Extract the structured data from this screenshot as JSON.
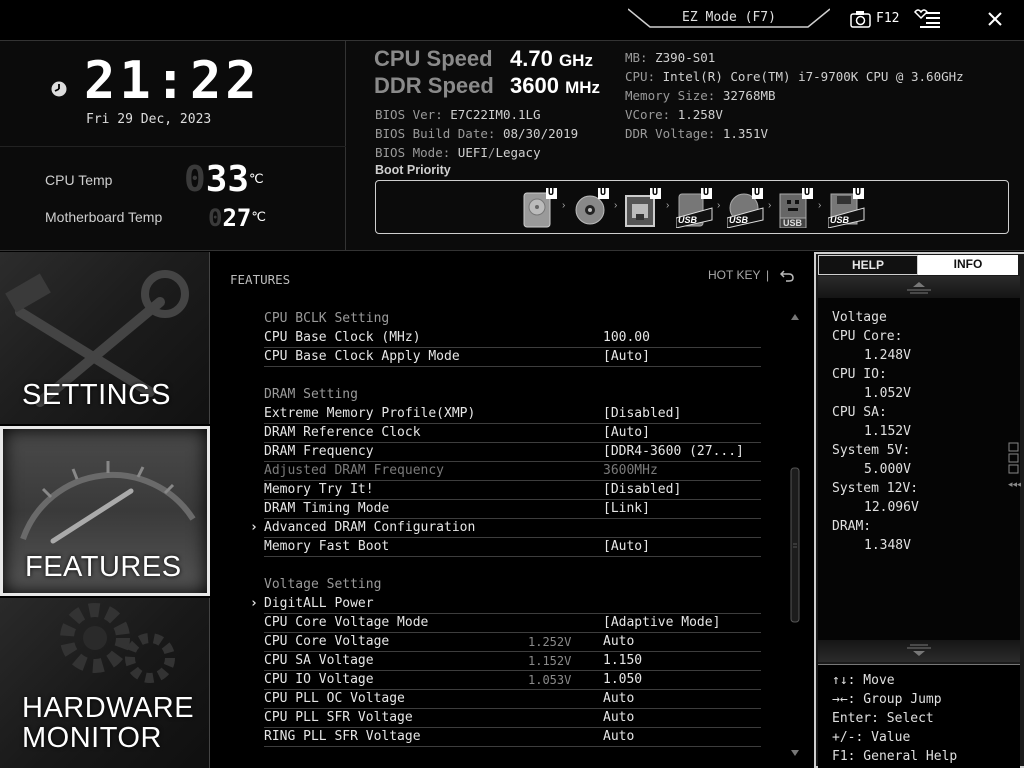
{
  "topbar": {
    "ez_mode": "EZ Mode (F7)",
    "f12": "F12"
  },
  "clock": {
    "time_digits": [
      "2",
      "1",
      ":",
      "2",
      "2"
    ],
    "date": "Fri  29 Dec, 2023"
  },
  "temps": {
    "cpu_label": "CPU Temp",
    "cpu_value": "33",
    "cpu_unit": "℃",
    "mb_label": "Motherboard Temp",
    "mb_value": "27",
    "mb_unit": "℃"
  },
  "speeds": {
    "cpu_label": "CPU Speed",
    "cpu_value": "4.70",
    "cpu_unit": "GHz",
    "ddr_label": "DDR Speed",
    "ddr_value": "3600",
    "ddr_unit": "MHz"
  },
  "bios": {
    "ver_label": "BIOS Ver:",
    "ver": "E7C22IM0.1LG",
    "build_label": "BIOS Build Date:",
    "build": "08/30/2019",
    "mode_label": "BIOS Mode:",
    "mode_a": "UEFI",
    "mode_sep": "/",
    "mode_b": "Legacy"
  },
  "system": {
    "mb_label": "MB:",
    "mb": "Z390-S01",
    "cpu_label": "CPU:",
    "cpu": "Intel(R) Core(TM) i7-9700K CPU @ 3.60GHz",
    "mem_label": "Memory Size:",
    "mem": "32768MB",
    "vcore_label": "VCore:",
    "vcore": "1.258V",
    "ddrv_label": "DDR Voltage:",
    "ddrv": "1.351V"
  },
  "boot": {
    "label": "Boot Priority",
    "badge": "U",
    "devices": [
      "hdd",
      "optical",
      "network",
      "usb",
      "usb",
      "usb",
      "usb"
    ],
    "usb_text": "USB"
  },
  "nav": {
    "settings": "SETTINGS",
    "features": "FEATURES",
    "hw_line1": "HARDWARE",
    "hw_line2": "MONITOR"
  },
  "main": {
    "title": "FEATURES",
    "hotkey": "HOT KEY",
    "hotkey_sep": "|",
    "rows": [
      {
        "label": "CPU BCLK Setting",
        "current": "",
        "value": "",
        "kind": "section"
      },
      {
        "label": "CPU Base Clock (MHz)",
        "current": "",
        "value": "100.00",
        "kind": "item"
      },
      {
        "label": "CPU Base Clock Apply Mode",
        "current": "",
        "value": "[Auto]",
        "kind": "item"
      },
      {
        "label": "DRAM Setting",
        "current": "",
        "value": "",
        "kind": "section"
      },
      {
        "label": "Extreme Memory Profile(XMP)",
        "current": "",
        "value": "[Disabled]",
        "kind": "item"
      },
      {
        "label": "DRAM Reference Clock",
        "current": "",
        "value": "[Auto]",
        "kind": "item"
      },
      {
        "label": "DRAM Frequency",
        "current": "",
        "value": "[DDR4-3600 (27...]",
        "kind": "item"
      },
      {
        "label": "Adjusted DRAM Frequency",
        "current": "",
        "value": "3600MHz",
        "kind": "disabled"
      },
      {
        "label": "Memory Try It!",
        "current": "",
        "value": "[Disabled]",
        "kind": "item"
      },
      {
        "label": "DRAM Timing Mode",
        "current": "",
        "value": "[Link]",
        "kind": "item"
      },
      {
        "label": "Advanced DRAM Configuration",
        "current": "",
        "value": "",
        "kind": "submenu"
      },
      {
        "label": "Memory Fast Boot",
        "current": "",
        "value": "[Auto]",
        "kind": "item"
      },
      {
        "label": "Voltage Setting",
        "current": "",
        "value": "",
        "kind": "section"
      },
      {
        "label": "DigitALL Power",
        "current": "",
        "value": "",
        "kind": "submenu"
      },
      {
        "label": "CPU Core Voltage Mode",
        "current": "",
        "value": "[Adaptive Mode]",
        "kind": "item"
      },
      {
        "label": "CPU Core Voltage",
        "current": "1.252V",
        "value": "Auto",
        "kind": "item"
      },
      {
        "label": "CPU SA Voltage",
        "current": "1.152V",
        "value": "1.150",
        "kind": "item"
      },
      {
        "label": "CPU IO Voltage",
        "current": "1.053V",
        "value": "1.050",
        "kind": "item"
      },
      {
        "label": "CPU PLL OC Voltage",
        "current": "",
        "value": "Auto",
        "kind": "item"
      },
      {
        "label": "CPU PLL SFR Voltage",
        "current": "",
        "value": "Auto",
        "kind": "item"
      },
      {
        "label": "RING PLL SFR Voltage",
        "current": "",
        "value": "Auto",
        "kind": "item"
      }
    ]
  },
  "right": {
    "tab_help": "HELP",
    "tab_info": "INFO",
    "info": [
      {
        "text": "Voltage",
        "indent": false
      },
      {
        "text": "CPU Core:",
        "indent": false
      },
      {
        "text": "1.248V",
        "indent": true
      },
      {
        "text": "CPU IO:",
        "indent": false
      },
      {
        "text": "1.052V",
        "indent": true
      },
      {
        "text": "CPU SA:",
        "indent": false
      },
      {
        "text": "1.152V",
        "indent": true
      },
      {
        "text": "System 5V:",
        "indent": false
      },
      {
        "text": "5.000V",
        "indent": true
      },
      {
        "text": "System 12V:",
        "indent": false
      },
      {
        "text": "12.096V",
        "indent": true
      },
      {
        "text": "DRAM:",
        "indent": false
      },
      {
        "text": "1.348V",
        "indent": true
      }
    ],
    "help": [
      "↑↓: Move",
      "→←: Group Jump",
      "Enter: Select",
      "+/-: Value",
      "F1: General Help"
    ]
  }
}
